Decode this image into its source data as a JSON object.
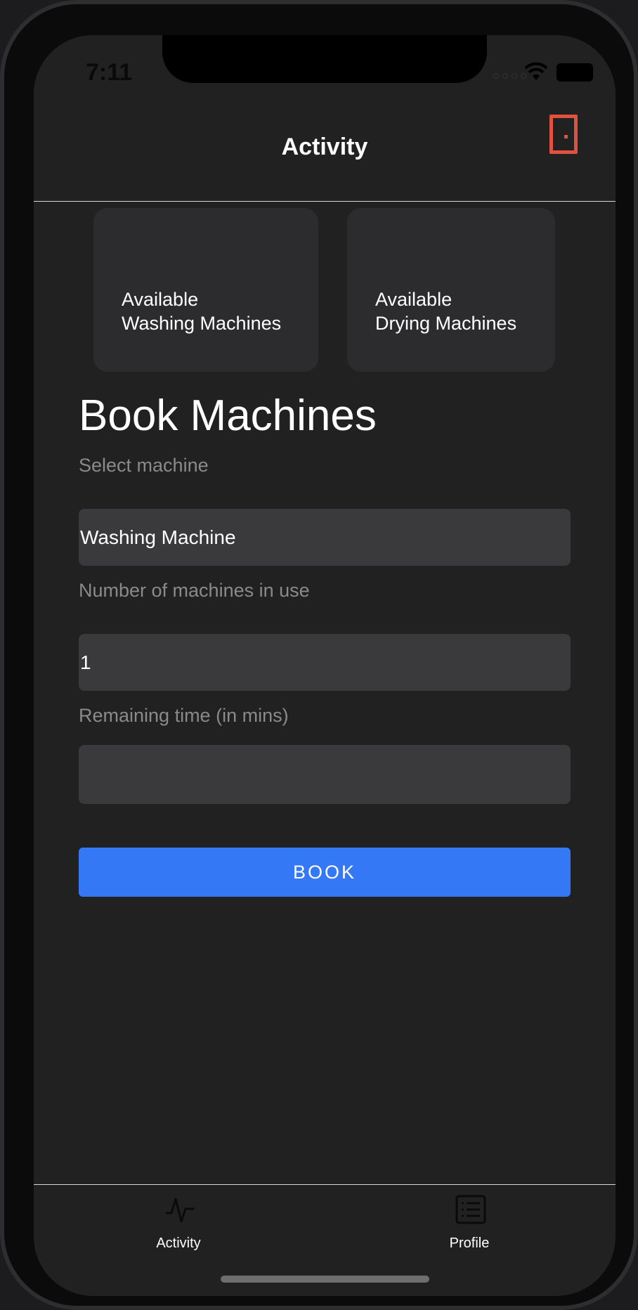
{
  "status_bar": {
    "time": "7:11"
  },
  "header": {
    "title": "Activity",
    "logout_icon": "door-icon"
  },
  "cards": [
    {
      "line1": "Available",
      "line2": "Washing Machines"
    },
    {
      "line1": "Available",
      "line2": "Drying Machines"
    }
  ],
  "booking": {
    "title": "Book Machines",
    "select_label": "Select machine",
    "select_value": "Washing Machine",
    "count_label": "Number of machines in use",
    "count_value": "1",
    "time_label": "Remaining time (in mins)",
    "time_value": "",
    "button_label": "BOOK"
  },
  "tabbar": {
    "tabs": [
      {
        "label": "Activity",
        "icon": "activity-pulse-icon"
      },
      {
        "label": "Profile",
        "icon": "list-document-icon"
      }
    ]
  },
  "colors": {
    "background": "#212121",
    "card": "#2c2c2e",
    "field": "#3a3a3c",
    "accent": "#3478f6",
    "logout": "#e0523f"
  }
}
